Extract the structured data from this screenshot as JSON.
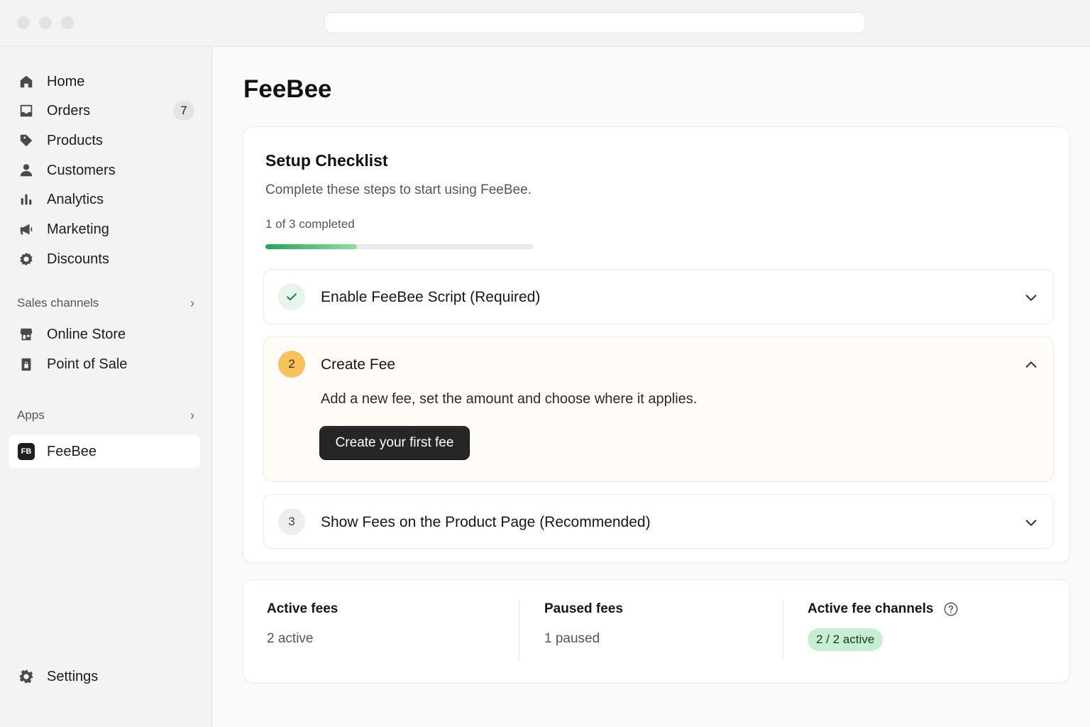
{
  "nav": {
    "items": [
      {
        "label": "Home",
        "icon": "home-icon"
      },
      {
        "label": "Orders",
        "icon": "inbox-icon",
        "badge": "7"
      },
      {
        "label": "Products",
        "icon": "tag-icon"
      },
      {
        "label": "Customers",
        "icon": "person-icon"
      },
      {
        "label": "Analytics",
        "icon": "bar-chart-icon"
      },
      {
        "label": "Marketing",
        "icon": "megaphone-icon"
      },
      {
        "label": "Discounts",
        "icon": "discount-icon"
      }
    ],
    "sales_channels": {
      "heading": "Sales channels",
      "items": [
        {
          "label": "Online Store",
          "icon": "store-icon"
        },
        {
          "label": "Point of Sale",
          "icon": "lock-icon"
        }
      ]
    },
    "apps": {
      "heading": "Apps",
      "items": [
        {
          "label": "FeeBee",
          "logo_text": "FB",
          "active": true
        }
      ]
    },
    "settings_label": "Settings"
  },
  "main": {
    "title": "FeeBee",
    "checklist": {
      "title": "Setup Checklist",
      "subtitle": "Complete these steps to start using FeeBee.",
      "progress_label": "1 of 3 completed",
      "progress_fraction": 0.34,
      "steps": [
        {
          "number": "",
          "label": "Enable FeeBee Script (Required)",
          "status": "complete",
          "expanded": false
        },
        {
          "number": "2",
          "label": "Create Fee",
          "status": "current",
          "expanded": true,
          "description": "Add a new fee, set the amount and choose where it applies.",
          "button_label": "Create your first fee"
        },
        {
          "number": "3",
          "label": "Show Fees on the Product Page (Recommended)",
          "status": "pending",
          "expanded": false
        }
      ]
    },
    "stats": {
      "active_fees": {
        "title": "Active fees",
        "value": "2 active"
      },
      "paused_fees": {
        "title": "Paused fees",
        "value": "1 paused"
      },
      "active_channels": {
        "title": "Active fee channels",
        "value": "2 / 2 active"
      }
    }
  },
  "colors": {
    "progress_green": "#26a25a",
    "step_current": "#f7c15b",
    "pill_green": "#c7eed3",
    "button_dark": "#262626"
  }
}
